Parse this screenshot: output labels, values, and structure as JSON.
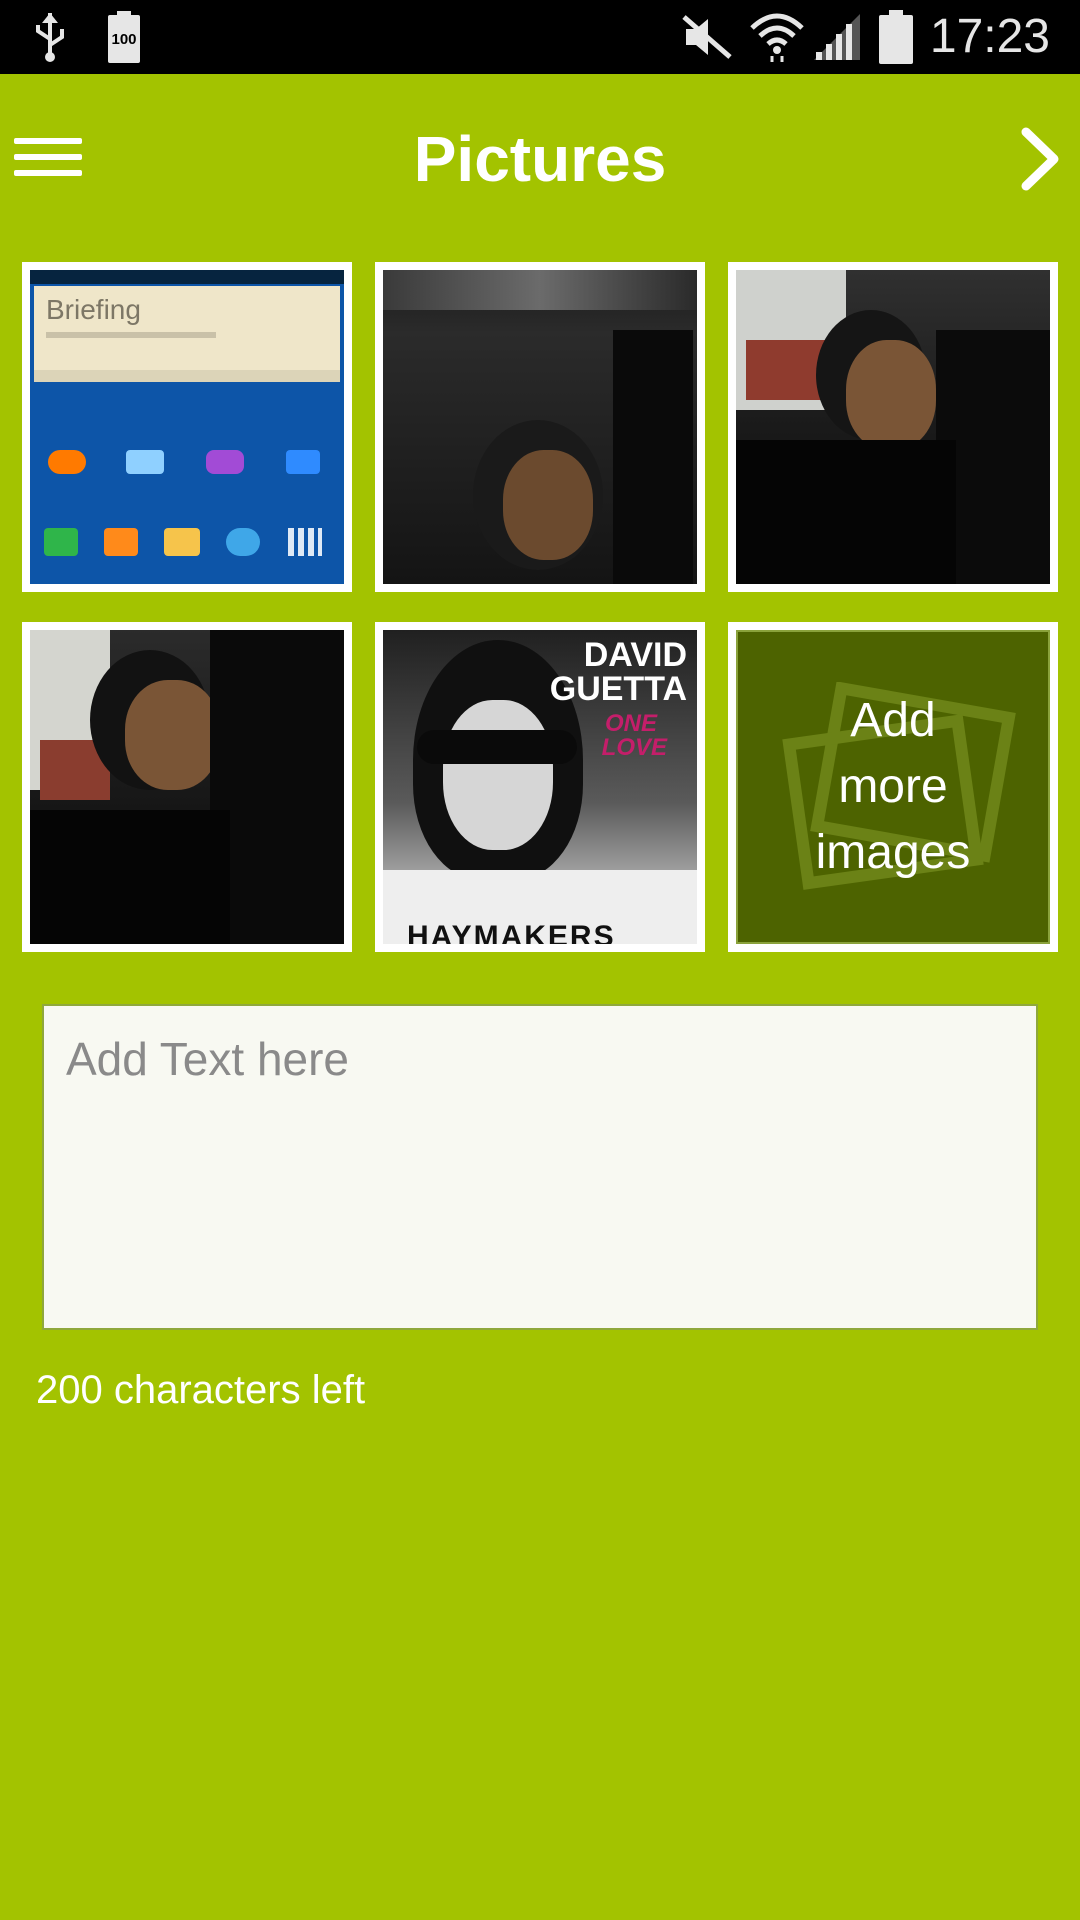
{
  "status_bar": {
    "time": "17:23",
    "battery_level": "100",
    "icons": [
      "usb-icon",
      "battery-icon",
      "mute-icon",
      "wifi-icon",
      "signal-icon",
      "battery-full-icon"
    ]
  },
  "app_bar": {
    "title": "Pictures",
    "menu_icon": "menu-icon",
    "next_icon": "chevron-right-icon"
  },
  "gallery": {
    "items": [
      {
        "kind": "screenshot",
        "name": "Home screen screenshot",
        "briefing_label": "Briefing"
      },
      {
        "kind": "photo",
        "name": "Selfie photo 1"
      },
      {
        "kind": "photo",
        "name": "Selfie photo 2"
      },
      {
        "kind": "photo",
        "name": "Selfie photo 3"
      },
      {
        "kind": "album",
        "name": "David Guetta One Love cover",
        "line1": "DAVID",
        "line2": "GUETTA",
        "line3": "ONE",
        "line4": "LOVE",
        "shirt": "HAYMAKERS"
      },
      {
        "kind": "add",
        "label_line1": "Add",
        "label_line2": "more",
        "label_line3": "images"
      }
    ]
  },
  "text_input": {
    "placeholder": "Add Text here",
    "value": ""
  },
  "counter": {
    "text": "200 characters left"
  },
  "colors": {
    "background": "#a3c300",
    "add_tile": "#4d6300",
    "status_bar": "#000000"
  }
}
